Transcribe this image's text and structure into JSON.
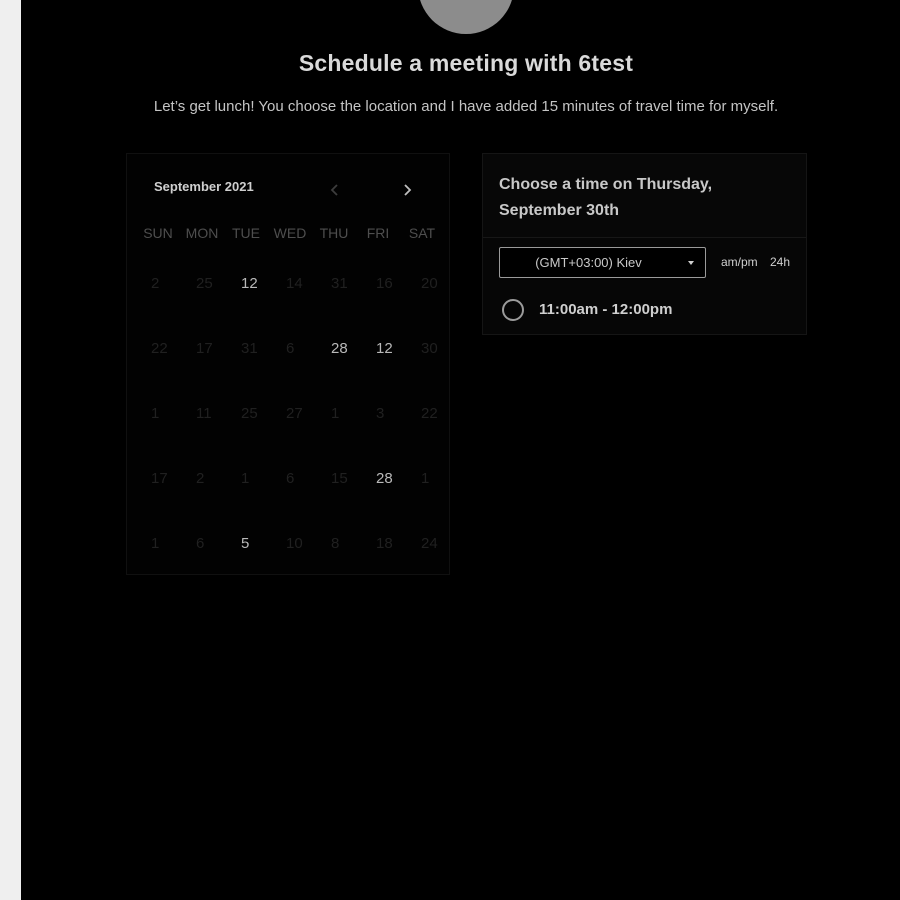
{
  "header": {
    "title": "Schedule a meeting with 6test",
    "description": "Let’s get lunch! You choose the location and I have added 15 minutes of travel time for myself."
  },
  "calendar": {
    "month_label": "September 2021",
    "prev_icon": "chevron-left-icon",
    "next_icon": "chevron-right-icon",
    "weekdays": [
      "SUN",
      "MON",
      "TUE",
      "WED",
      "THU",
      "FRI",
      "SAT"
    ],
    "days": [
      {
        "label": "2",
        "active": false
      },
      {
        "label": "25",
        "active": false
      },
      {
        "label": "12",
        "active": true
      },
      {
        "label": "14",
        "active": false
      },
      {
        "label": "31",
        "active": false
      },
      {
        "label": "16",
        "active": false
      },
      {
        "label": "20",
        "active": false
      },
      {
        "label": "22",
        "active": false
      },
      {
        "label": "17",
        "active": false
      },
      {
        "label": "31",
        "active": false
      },
      {
        "label": "6",
        "active": false
      },
      {
        "label": "28",
        "active": true
      },
      {
        "label": "12",
        "active": true
      },
      {
        "label": "30",
        "active": false
      },
      {
        "label": "1",
        "active": false
      },
      {
        "label": "11",
        "active": false
      },
      {
        "label": "25",
        "active": false
      },
      {
        "label": "27",
        "active": false
      },
      {
        "label": "1",
        "active": false
      },
      {
        "label": "3",
        "active": false
      },
      {
        "label": "22",
        "active": false
      },
      {
        "label": "17",
        "active": false
      },
      {
        "label": "2",
        "active": false
      },
      {
        "label": "1",
        "active": false
      },
      {
        "label": "6",
        "active": false
      },
      {
        "label": "15",
        "active": false
      },
      {
        "label": "28",
        "active": true
      },
      {
        "label": "1",
        "active": false
      },
      {
        "label": "1",
        "active": false
      },
      {
        "label": "6",
        "active": false
      },
      {
        "label": "5",
        "active": true
      },
      {
        "label": "10",
        "active": false
      },
      {
        "label": "8",
        "active": false
      },
      {
        "label": "18",
        "active": false
      },
      {
        "label": "24",
        "active": false
      }
    ]
  },
  "timepicker": {
    "title": "Choose a time on Thursday, September 30th",
    "timezone_value": "(GMT+03:00) Kiev",
    "format_ampm": "am/pm",
    "format_24h": "24h",
    "slots": [
      {
        "label": "11:00am - 12:00pm",
        "selected": false
      }
    ]
  }
}
